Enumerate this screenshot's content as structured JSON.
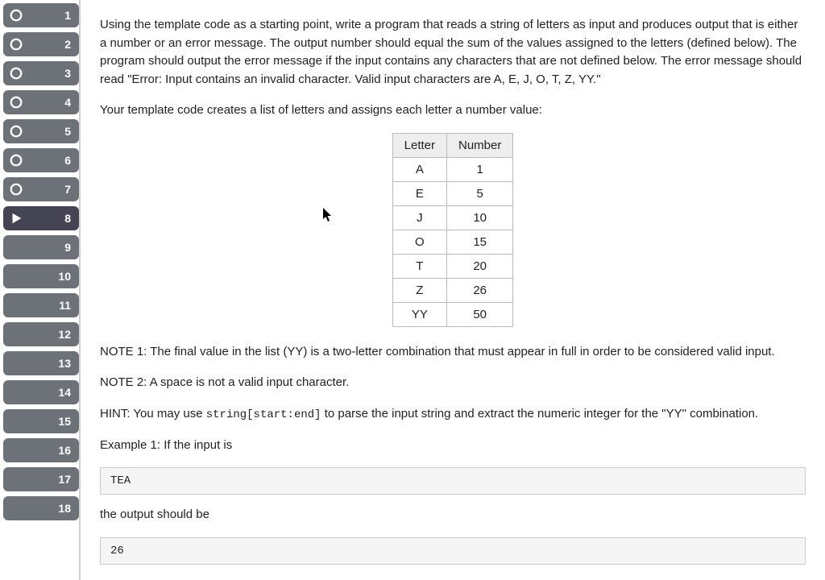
{
  "sidebar": {
    "steps": [
      {
        "num": "1",
        "status": "circle",
        "active": false
      },
      {
        "num": "2",
        "status": "circle",
        "active": false
      },
      {
        "num": "3",
        "status": "circle",
        "active": false
      },
      {
        "num": "4",
        "status": "circle",
        "active": false
      },
      {
        "num": "5",
        "status": "circle",
        "active": false
      },
      {
        "num": "6",
        "status": "circle",
        "active": false
      },
      {
        "num": "7",
        "status": "circle",
        "active": false
      },
      {
        "num": "8",
        "status": "play",
        "active": true
      },
      {
        "num": "9",
        "status": "none",
        "active": false
      },
      {
        "num": "10",
        "status": "none",
        "active": false
      },
      {
        "num": "11",
        "status": "none",
        "active": false
      },
      {
        "num": "12",
        "status": "none",
        "active": false
      },
      {
        "num": "13",
        "status": "none",
        "active": false
      },
      {
        "num": "14",
        "status": "none",
        "active": false
      },
      {
        "num": "15",
        "status": "none",
        "active": false
      },
      {
        "num": "16",
        "status": "none",
        "active": false
      },
      {
        "num": "17",
        "status": "none",
        "active": false
      },
      {
        "num": "18",
        "status": "none",
        "active": false
      }
    ]
  },
  "content": {
    "para1": "Using the template code as a starting point, write a program that reads a string of letters as input and produces output that is either a number or an error message. The output number should equal the sum of the values assigned to the letters (defined below). The program should output the error message if the input contains any characters that are not defined below. The error message should read \"Error: Input contains an invalid character. Valid input characters are A, E, J, O, T, Z, YY.\"",
    "para2": "Your template code creates a list of letters and assigns each letter a number value:",
    "table": {
      "head_letter": "Letter",
      "head_number": "Number",
      "rows": [
        {
          "letter": "A",
          "number": "1"
        },
        {
          "letter": "E",
          "number": "5"
        },
        {
          "letter": "J",
          "number": "10"
        },
        {
          "letter": "O",
          "number": "15"
        },
        {
          "letter": "T",
          "number": "20"
        },
        {
          "letter": "Z",
          "number": "26"
        },
        {
          "letter": "YY",
          "number": "50"
        }
      ]
    },
    "note1": "NOTE 1: The final value in the list (YY) is a two-letter combination that must appear in full in order to be considered valid input.",
    "note2": "NOTE 2: A space is not a valid input character.",
    "hint_prefix": "HINT: You may use ",
    "hint_code": "string[start:end]",
    "hint_suffix": " to parse the input string and extract the numeric integer for the \"YY\" combination.",
    "example_label": "Example 1: If the input is",
    "example_input": "TEA",
    "output_label": "the output should be",
    "example_output": "26"
  }
}
